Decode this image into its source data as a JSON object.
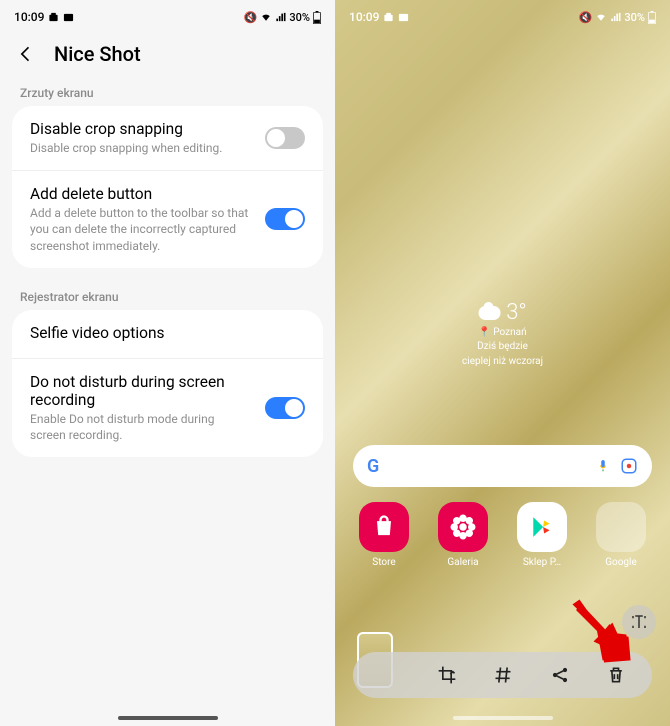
{
  "status": {
    "time": "10:09",
    "battery": "30%",
    "icons": "📷 🖼"
  },
  "header": {
    "title": "Nice Shot"
  },
  "sections": [
    {
      "label": "Zrzuty ekranu",
      "items": [
        {
          "title": "Disable crop snapping",
          "sub": "Disable crop snapping when editing.",
          "toggle": "off"
        },
        {
          "title": "Add delete button",
          "sub": "Add a delete button to the toolbar so that you can delete the incorrectly captured screenshot immediately.",
          "toggle": "on"
        }
      ]
    },
    {
      "label": "Rejestrator ekranu",
      "items": [
        {
          "title": "Selfie video options"
        },
        {
          "title": "Do not disturb during screen recording",
          "sub": "Enable Do not disturb mode during screen recording.",
          "toggle": "on"
        }
      ]
    }
  ],
  "weather": {
    "temp": "3°",
    "loc": "Poznań",
    "line1": "Dziś będzie",
    "line2": "cieplej niż wczoraj"
  },
  "apps": [
    {
      "label": "Store"
    },
    {
      "label": "Galeria"
    },
    {
      "label": "Sklep P…"
    },
    {
      "label": "Google"
    }
  ]
}
